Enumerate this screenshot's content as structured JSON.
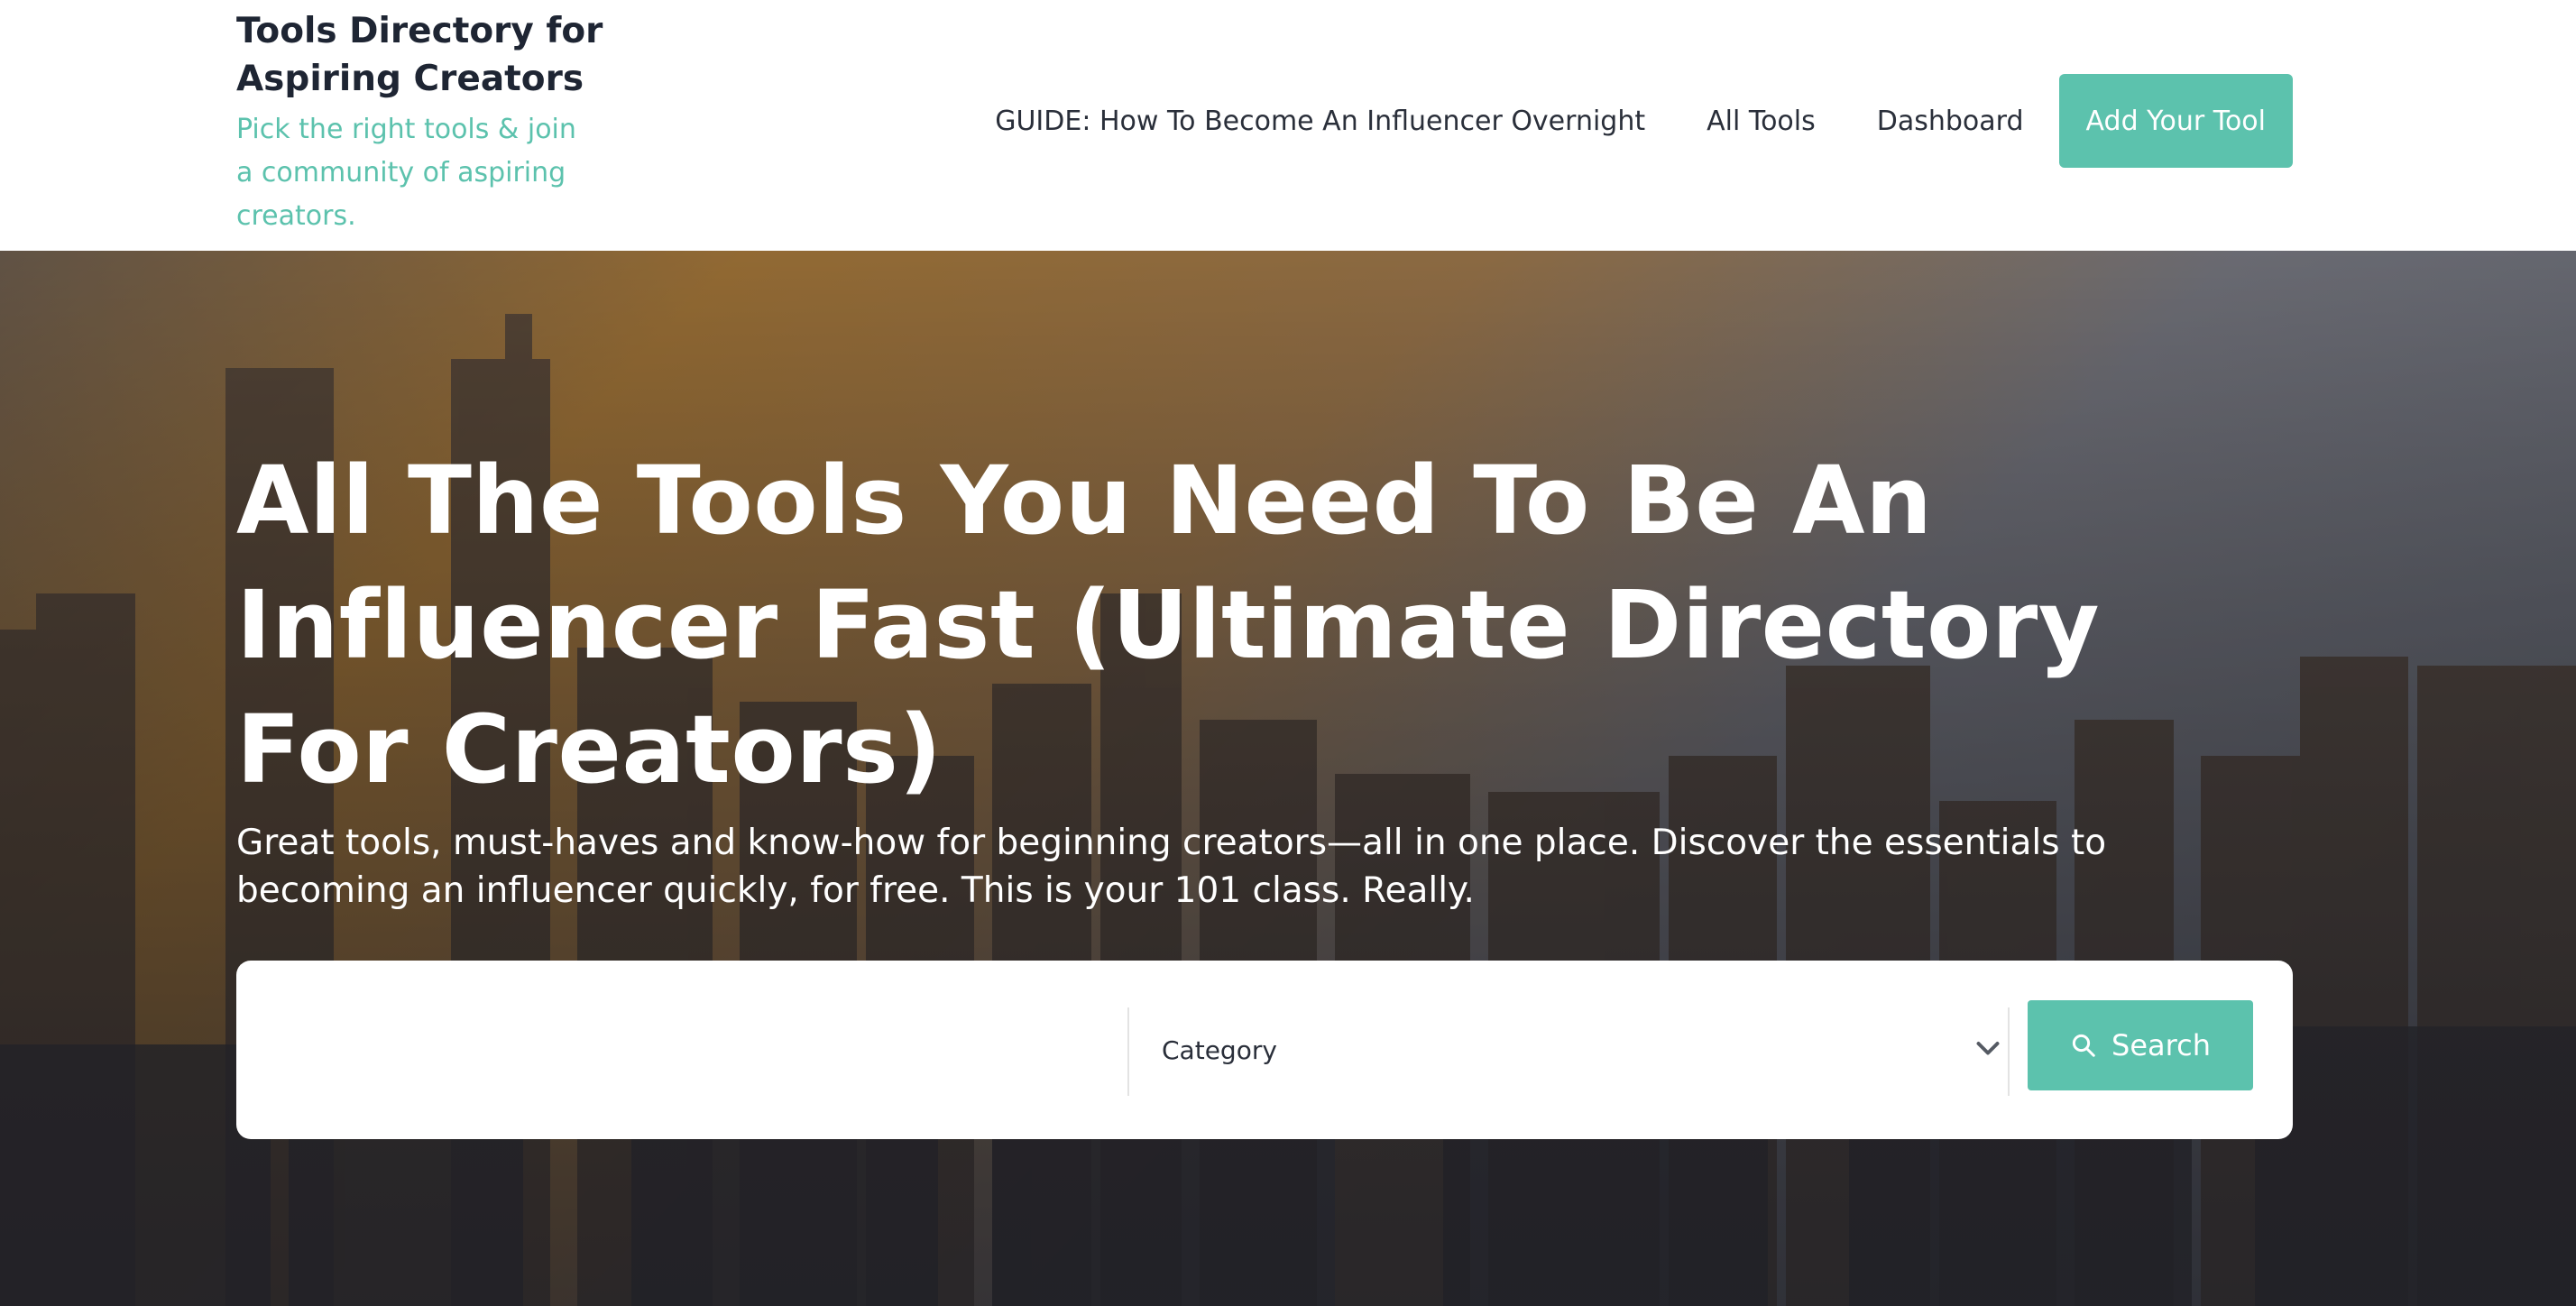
{
  "brand": {
    "title": "Tools Directory for Aspiring Creators",
    "tagline": "Pick the right tools & join a community of aspiring creators."
  },
  "nav": {
    "guide": "GUIDE: How To Become An Influencer Overnight",
    "all_tools": "All Tools",
    "dashboard": "Dashboard",
    "cta": "Add Your Tool"
  },
  "hero": {
    "title": "All The Tools You Need To Be An Influencer Fast (Ultimate Directory For Creators)",
    "subtitle": "Great tools, must-haves and know-how for beginning creators—all in one place. Discover the essentials to becoming an influencer quickly, for free. This is your 101 class. Really."
  },
  "search": {
    "keyword_placeholder": "",
    "category_selected": "Category",
    "button_label": "Search"
  },
  "icons": {
    "search": "search-icon",
    "chevron": "chevron-down-icon"
  },
  "colors": {
    "accent": "#5cc2ad",
    "brand_text": "#1e2533"
  }
}
